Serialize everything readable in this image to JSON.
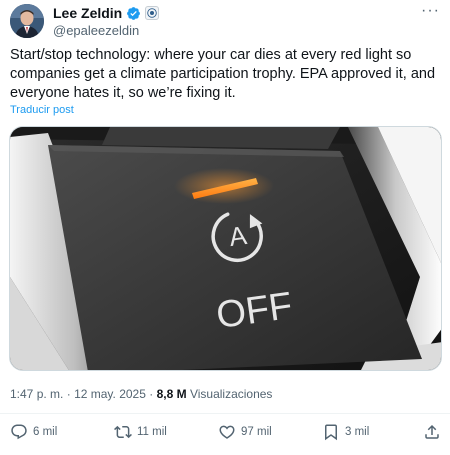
{
  "author": {
    "name": "Lee Zeldin",
    "handle": "@epaleezeldin"
  },
  "tweet": {
    "text": "Start/stop technology: where your car dies at every red light so companies get a climate participation trophy. EPA approved it, and everyone hates it, so we’re fixing it.",
    "translate_label": "Traducir post",
    "time": "1:47 p. m.",
    "date": "12 may. 2025",
    "views_count": "8,8 M",
    "views_label": "Visualizaciones"
  },
  "media": {
    "button_label": "OFF",
    "button_letter": "A",
    "indicator_color": "#ff8a1c"
  },
  "actions": {
    "replies": "6 mil",
    "reposts": "11 mil",
    "likes": "97 mil",
    "bookmarks": "3 mil"
  },
  "colors": {
    "link": "#1d9bf0",
    "verified": "#1d9bf0",
    "muted": "#536471"
  }
}
